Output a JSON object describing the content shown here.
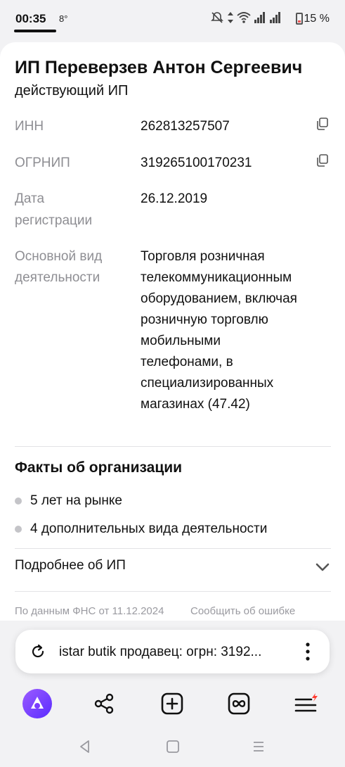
{
  "status": {
    "time": "00:35",
    "temperature": "8°",
    "battery": "15 %"
  },
  "company": {
    "name": "ИП Переверзев Антон Сергеевич",
    "status": "действующий ИП"
  },
  "details": {
    "inn_label": "ИНН",
    "inn_value": "262813257507",
    "ogrnip_label": "ОГРНИП",
    "ogrnip_value": "319265100170231",
    "reg_label_1": "Дата",
    "reg_label_2": "регистрации",
    "reg_value": "26.12.2019",
    "activity_label_1": "Основной вид",
    "activity_label_2": "деятельности",
    "activity_lines": [
      "Торговля розничная",
      "телекоммуникационным",
      "оборудованием, включая",
      "розничную торговлю",
      "мобильными",
      "телефонами, в",
      "специализированных",
      "магазинах (47.42)"
    ]
  },
  "facts": {
    "title": "Факты об организации",
    "items": [
      "5 лет на рынке",
      "4 дополнительных вида деятельности"
    ]
  },
  "more": {
    "label": "Подробнее об ИП"
  },
  "footer": {
    "source": "По данным ФНС от 11.12.2024",
    "report": "Сообщить об ошибке"
  },
  "search": {
    "query": "istar butik продавец: огрн: 3192..."
  },
  "colors": {
    "alice_purple": "#7b3cff",
    "notify_red": "#ff3b30"
  }
}
